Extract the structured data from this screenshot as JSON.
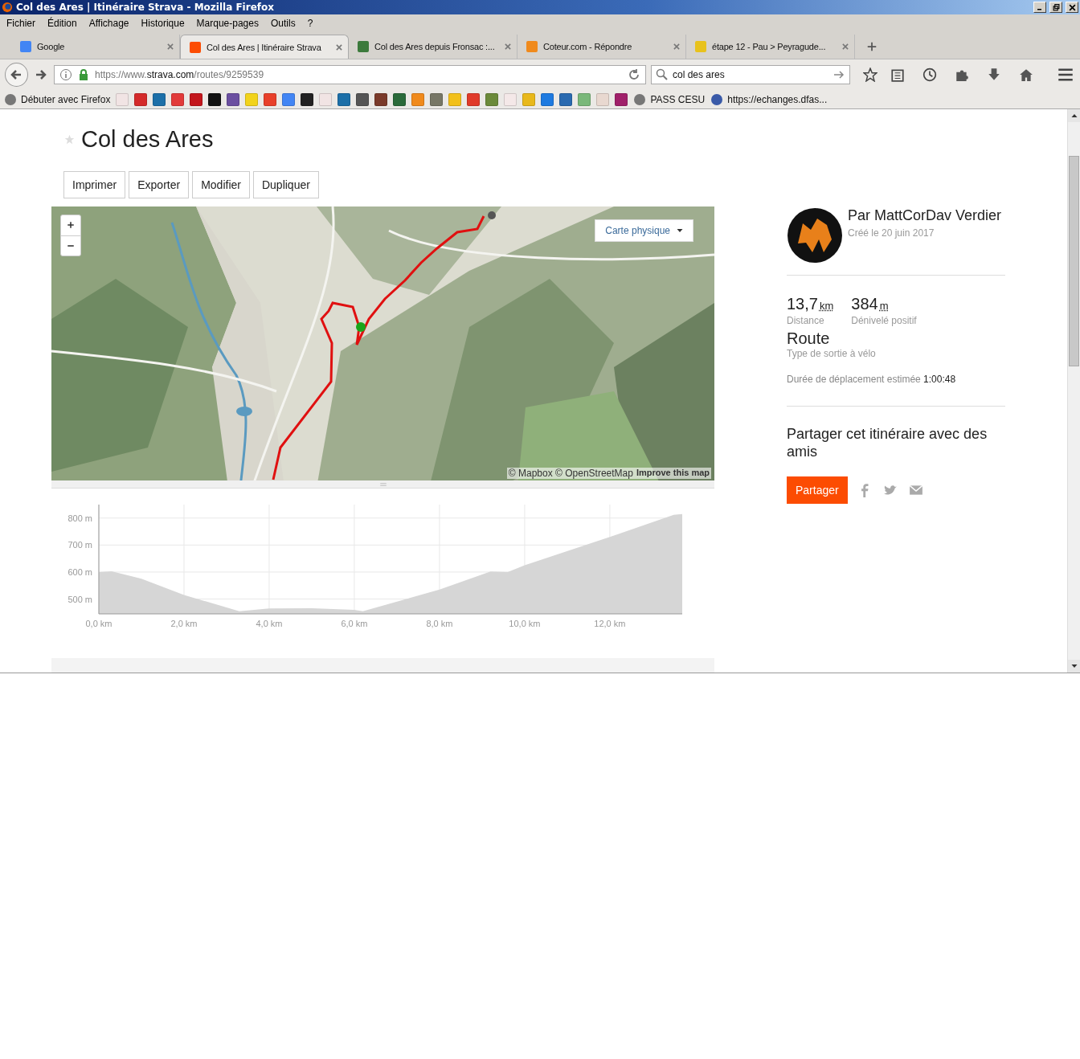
{
  "window": {
    "title": "Col des Ares | Itinéraire Strava - Mozilla Firefox"
  },
  "menu": [
    "Fichier",
    "Édition",
    "Affichage",
    "Historique",
    "Marque-pages",
    "Outils",
    "?"
  ],
  "tabs": [
    {
      "label": "Google",
      "selected": false,
      "color": "#4285f4"
    },
    {
      "label": "Col des Ares | Itinéraire Strava",
      "selected": true,
      "color": "#fc4c02"
    },
    {
      "label": "Col des Ares depuis Fronsac :...",
      "selected": false,
      "color": "#3c7a3c"
    },
    {
      "label": "Coteur.com - Répondre",
      "selected": false,
      "color": "#f08a1c"
    },
    {
      "label": "étape 12 - Pau > Peyragude...",
      "selected": false,
      "color": "#e8c21c"
    }
  ],
  "address_bar": {
    "prefix": "https://www.",
    "domain": "strava.com",
    "path": "/routes/9259539"
  },
  "search": {
    "value": "col des ares"
  },
  "bookmarks": [
    {
      "kind": "labeled",
      "label": "Débuter avec Firefox",
      "color": "#777777"
    },
    {
      "kind": "icon",
      "color": "#f1e4e4"
    },
    {
      "kind": "icon",
      "color": "#d42a2a"
    },
    {
      "kind": "icon",
      "color": "#1c6fa8"
    },
    {
      "kind": "icon",
      "color": "#e23a3a"
    },
    {
      "kind": "icon",
      "color": "#c3161c"
    },
    {
      "kind": "icon",
      "color": "#111111"
    },
    {
      "kind": "icon",
      "color": "#6b4fa0"
    },
    {
      "kind": "icon",
      "color": "#f2d31b"
    },
    {
      "kind": "icon",
      "color": "#e8402a"
    },
    {
      "kind": "icon",
      "color": "#4285f4"
    },
    {
      "kind": "icon",
      "color": "#222222"
    },
    {
      "kind": "icon",
      "color": "#f1e4e4"
    },
    {
      "kind": "icon",
      "color": "#1c6fa8"
    },
    {
      "kind": "icon",
      "color": "#555555"
    },
    {
      "kind": "icon",
      "color": "#7a3a2a"
    },
    {
      "kind": "icon",
      "color": "#2a6a3a"
    },
    {
      "kind": "icon",
      "color": "#f08a1c"
    },
    {
      "kind": "icon",
      "color": "#777766"
    },
    {
      "kind": "icon",
      "color": "#f2c01b"
    },
    {
      "kind": "icon",
      "color": "#e03a2a"
    },
    {
      "kind": "icon",
      "color": "#6b8a3a"
    },
    {
      "kind": "icon",
      "color": "#f4e8e8"
    },
    {
      "kind": "icon",
      "color": "#e8b81b"
    },
    {
      "kind": "icon",
      "color": "#1e7ae0"
    },
    {
      "kind": "icon",
      "color": "#2a6ab0"
    },
    {
      "kind": "icon",
      "color": "#7ab87a"
    },
    {
      "kind": "icon",
      "color": "#e8d8d0"
    },
    {
      "kind": "icon",
      "color": "#a0206a"
    },
    {
      "kind": "labeled",
      "label": "PASS CESU",
      "color": "#777777"
    },
    {
      "kind": "labeled",
      "label": "https://echanges.dfas...",
      "color": "#3a5aa8"
    }
  ],
  "page": {
    "title": "Col des Ares",
    "actions": [
      "Imprimer",
      "Exporter",
      "Modifier",
      "Dupliquer"
    ],
    "map": {
      "style_menu": "Carte physique",
      "attribution": "© Mapbox © OpenStreetMap",
      "improve_link": "Improve this map"
    },
    "elevation": {
      "chart_data": {
        "type": "area",
        "x": [
          0,
          0.3,
          1,
          2,
          3.3,
          4,
          5,
          6,
          6.2,
          8,
          9.2,
          9.6,
          10,
          12,
          13.5,
          13.7
        ],
        "grid": true,
        "series": [
          {
            "color": "#d6d6d6",
            "values": [
              600,
              603,
              575,
              515,
              455,
              465,
              466,
              460,
              455,
              535,
              602,
              600,
              625,
              730,
              812,
              815
            ]
          }
        ],
        "xlim": [
          0,
          13.7
        ],
        "ylim": [
          445,
          850
        ],
        "xticks": [
          {
            "value": 0,
            "label": "0,0 km"
          },
          {
            "value": 2,
            "label": "2,0 km"
          },
          {
            "value": 4,
            "label": "4,0 km"
          },
          {
            "value": 6,
            "label": "6,0 km"
          },
          {
            "value": 8,
            "label": "8,0 km"
          },
          {
            "value": 10,
            "label": "10,0 km"
          },
          {
            "value": 12,
            "label": "12,0 km"
          }
        ],
        "yticks": [
          {
            "value": 500,
            "label": "500 m"
          },
          {
            "value": 600,
            "label": "600 m"
          },
          {
            "value": 700,
            "label": "700 m"
          },
          {
            "value": 800,
            "label": "800 m"
          }
        ]
      }
    },
    "author": {
      "name": "Par MattCorDav Verdier",
      "created": "Créé le 20 juin 2017"
    },
    "stats": [
      {
        "value": "13,7",
        "unit": "km",
        "label": "Distance"
      },
      {
        "value": "384",
        "unit": "m",
        "label": "Dénivelé positif"
      }
    ],
    "ride_type": {
      "value": "Route",
      "label": "Type de sortie à vélo"
    },
    "duration": {
      "label": "Durée de déplacement estimée",
      "value": "1:00:48"
    },
    "share": {
      "heading": "Partager cet itinéraire avec des amis",
      "button": "Partager"
    }
  }
}
